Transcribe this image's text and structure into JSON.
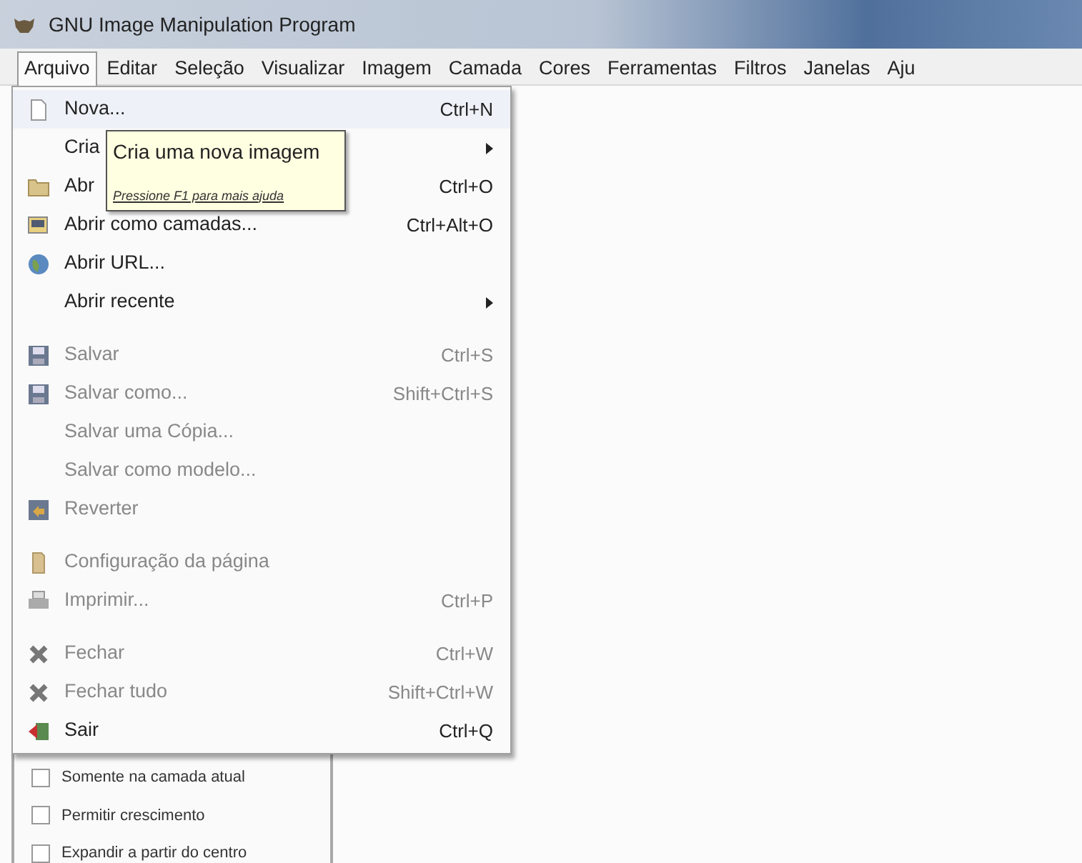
{
  "window": {
    "title": "GNU Image Manipulation Program"
  },
  "menubar": [
    {
      "label": "Arquivo",
      "selected": true
    },
    {
      "label": "Editar",
      "selected": false
    },
    {
      "label": "Seleção",
      "selected": false
    },
    {
      "label": "Visualizar",
      "selected": false
    },
    {
      "label": "Imagem",
      "selected": false
    },
    {
      "label": "Camada",
      "selected": false
    },
    {
      "label": "Cores",
      "selected": false
    },
    {
      "label": "Ferramentas",
      "selected": false
    },
    {
      "label": "Filtros",
      "selected": false
    },
    {
      "label": "Janelas",
      "selected": false
    },
    {
      "label": "Aju",
      "selected": false
    }
  ],
  "menu": {
    "items": [
      {
        "kind": "item",
        "label": "Nova...",
        "shortcut": "Ctrl+N",
        "disabled": false,
        "submenu": false
      },
      {
        "kind": "item",
        "label": "Cria",
        "disabled": false,
        "submenu": true
      },
      {
        "kind": "item",
        "label": "Abr",
        "shortcut": "Ctrl+O",
        "disabled": false,
        "submenu": false
      },
      {
        "kind": "item",
        "label": "Abrir como camadas...",
        "shortcut": "Ctrl+Alt+O",
        "disabled": false,
        "submenu": false
      },
      {
        "kind": "item",
        "label": "Abrir URL...",
        "disabled": false,
        "submenu": false
      },
      {
        "kind": "item",
        "label": "Abrir recente",
        "disabled": false,
        "submenu": true
      },
      {
        "kind": "separator"
      },
      {
        "kind": "item",
        "label": "Salvar",
        "shortcut": "Ctrl+S",
        "disabled": true,
        "submenu": false
      },
      {
        "kind": "item",
        "label": "Salvar como...",
        "shortcut": "Shift+Ctrl+S",
        "disabled": true,
        "submenu": false
      },
      {
        "kind": "item",
        "label": "Salvar uma Cópia...",
        "disabled": true,
        "submenu": false
      },
      {
        "kind": "item",
        "label": "Salvar como modelo...",
        "disabled": true,
        "submenu": false
      },
      {
        "kind": "item",
        "label": "Reverter",
        "disabled": true,
        "submenu": false
      },
      {
        "kind": "separator"
      },
      {
        "kind": "item",
        "label": "Configuração da página",
        "disabled": true,
        "submenu": false
      },
      {
        "kind": "item",
        "label": "Imprimir...",
        "shortcut": "Ctrl+P",
        "disabled": true,
        "submenu": false
      },
      {
        "kind": "separator"
      },
      {
        "kind": "item",
        "label": "Fechar",
        "shortcut": "Ctrl+W",
        "disabled": true,
        "submenu": false
      },
      {
        "kind": "item",
        "label": "Fechar tudo",
        "shortcut": "Shift+Ctrl+W",
        "disabled": true,
        "submenu": false
      },
      {
        "kind": "item",
        "label": "Sair",
        "shortcut": "Ctrl+Q",
        "disabled": false,
        "submenu": false
      }
    ]
  },
  "tooltip": {
    "title": "Cria uma nova imagem",
    "hint": "Pressione F1 para mais ajuda"
  },
  "options": [
    {
      "label": "Somente na camada atual",
      "checked": false
    },
    {
      "label": "Permitir crescimento",
      "checked": false
    },
    {
      "label": "Expandir a partir do centro",
      "checked": false
    }
  ]
}
